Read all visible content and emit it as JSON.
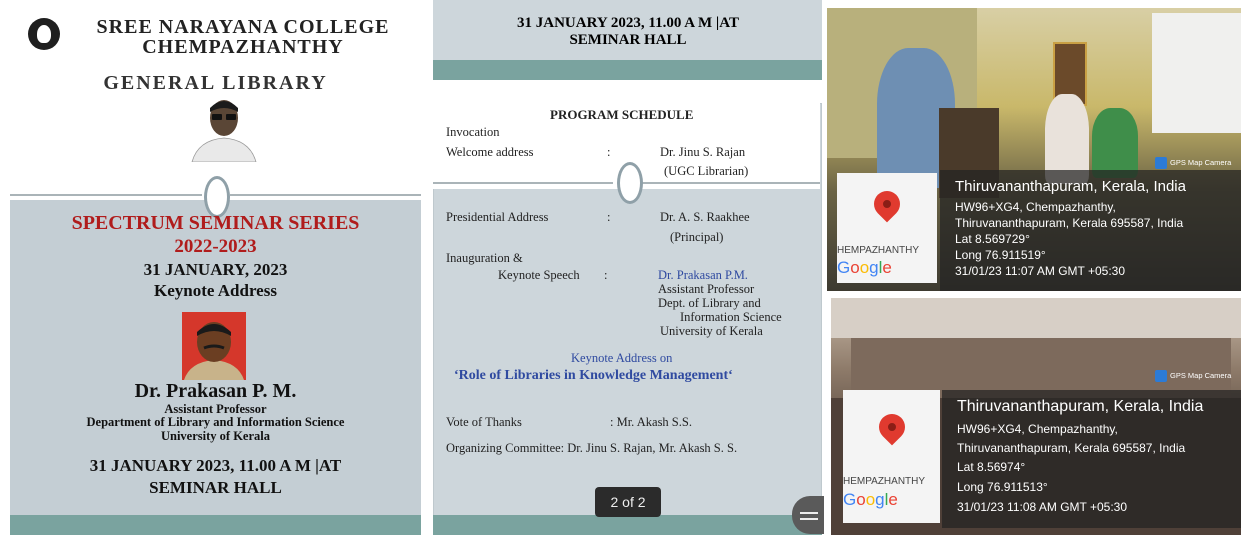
{
  "poster": {
    "college_line1": "SREE NARAYANA COLLEGE",
    "college_line2": "CHEMPAZHANTHY",
    "library": "GENERAL LIBRARY",
    "series_title": "SPECTRUM SEMINAR SERIES",
    "series_year": "2022-2023",
    "date": "31 JANUARY, 2023",
    "subtitle": "Keynote Address",
    "speaker_name": "Dr. Prakasan P. M.",
    "speaker_role": "Assistant Professor",
    "speaker_dept": "Department of Library and Information Science",
    "speaker_univ": "University of Kerala",
    "event_when": "31 JANUARY 2023, 11.00 A M |AT",
    "event_where": "SEMINAR HALL"
  },
  "schedule": {
    "top_when": "31 JANUARY 2023, 11.00 A M |AT",
    "top_where": "SEMINAR HALL",
    "heading": "PROGRAM SCHEDULE",
    "invocation": "Invocation",
    "welcome_label": "Welcome address",
    "sep": ":",
    "welcome_name": "Dr. Jinu S. Rajan",
    "welcome_role": "(UGC Librarian)",
    "presidential_label": "Presidential Address",
    "presidential_name": "Dr. A. S. Raakhee",
    "presidential_role": "(Principal)",
    "inaug_label": "Inauguration &",
    "keynote_label": "Keynote Speech",
    "keynote_name": "Dr. Prakasan P.M.",
    "keynote_role": "Assistant Professor",
    "keynote_dept1": "Dept. of Library and",
    "keynote_dept2": "Information Science",
    "keynote_univ": "University of Kerala",
    "topic_intro": "Keynote Address on",
    "topic": "‘Role of Libraries in Knowledge Management‘",
    "vote_label": "Vote of Thanks",
    "vote_name": ": Mr. Akash S.S.",
    "committee": "Organizing Committee: Dr. Jinu S. Rajan, Mr. Akash S. S.",
    "pager": "2 of 2"
  },
  "photo1": {
    "gps_badge": "GPS Map Camera",
    "map_city": "HEMPAZHANTHY",
    "google": [
      "G",
      "o",
      "o",
      "g",
      "l",
      "e"
    ],
    "place": "Thiruvananthapuram, Kerala, India",
    "address1": "HW96+XG4, Chempazhanthy,",
    "address2": "Thiruvananthapuram, Kerala 695587, India",
    "lat": "Lat 8.569729°",
    "long": "Long 76.911519°",
    "time": "31/01/23 11:07 AM GMT +05:30"
  },
  "photo2": {
    "gps_badge": "GPS Map Camera",
    "map_city": "HEMPAZHANTHY",
    "google": [
      "G",
      "o",
      "o",
      "g",
      "l",
      "e"
    ],
    "place": "Thiruvananthapuram, Kerala, India",
    "address1": "HW96+XG4, Chempazhanthy,",
    "address2": "Thiruvananthapuram, Kerala 695587, India",
    "lat": "Lat 8.56974°",
    "long": "Long 76.911513°",
    "time": "31/01/23 11:08 AM GMT +05:30"
  },
  "colors": {
    "title_red": "#b01c1c",
    "teal_band": "#7aa39f",
    "panel_grey": "#c4ced4",
    "link_blue": "#2f4aa0"
  }
}
